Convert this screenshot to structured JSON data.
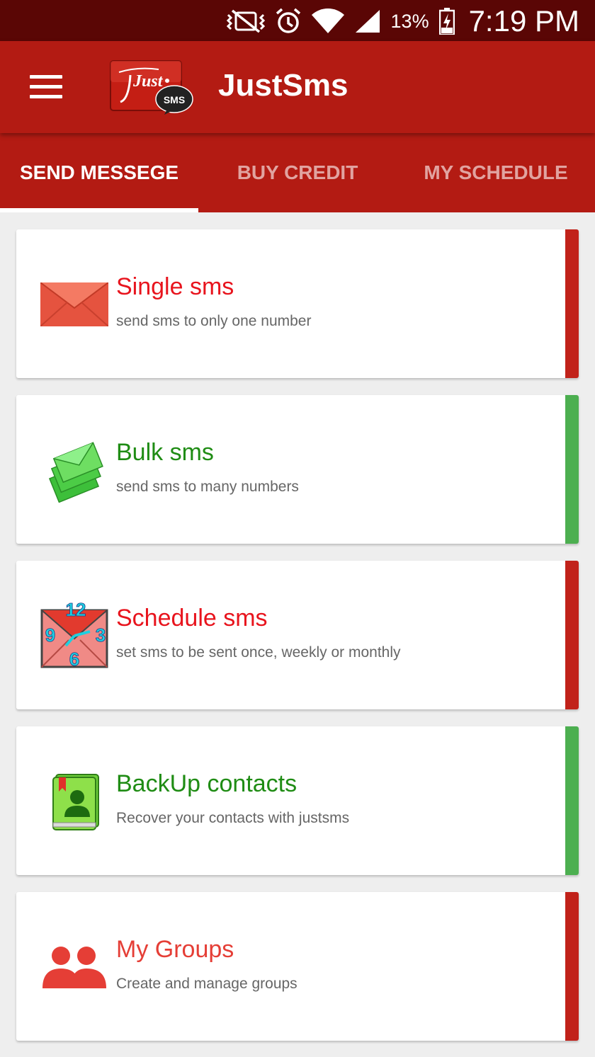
{
  "status_bar": {
    "battery_percent": "13%",
    "time": "7:19 PM",
    "icons": [
      "vibrate-icon",
      "alarm-icon",
      "wifi-icon",
      "signal-icon",
      "battery-charging-icon"
    ]
  },
  "app_bar": {
    "title": "JustSms",
    "logo_text": "Just",
    "logo_badge": "SMS",
    "menu_icon": "hamburger-menu-icon"
  },
  "tabs": [
    {
      "label": "SEND MESSEGE",
      "active": true
    },
    {
      "label": "BUY CREDIT",
      "active": false
    },
    {
      "label": "MY SCHEDULE",
      "active": false
    }
  ],
  "colors": {
    "primary": "#b31b13",
    "status_bar": "#5a0605",
    "red_accent": "#e8141d",
    "green_accent": "#1f8c14",
    "red_stripe": "#c1221a",
    "green_stripe": "#4caf50"
  },
  "cards": [
    {
      "title": "Single sms",
      "subtitle": "send sms to only one number",
      "icon": "envelope-icon",
      "accent": "red"
    },
    {
      "title": "Bulk sms",
      "subtitle": "send sms to many numbers",
      "icon": "stacked-envelopes-icon",
      "accent": "green"
    },
    {
      "title": "Schedule sms",
      "subtitle": "set sms to be sent once, weekly or monthly",
      "icon": "clock-envelope-icon",
      "accent": "red",
      "clock_numbers": [
        "12",
        "3",
        "6",
        "9"
      ]
    },
    {
      "title": "BackUp contacts",
      "subtitle": "Recover your contacts with justsms",
      "icon": "contacts-book-icon",
      "accent": "green"
    },
    {
      "title": "My Groups",
      "subtitle": "Create and manage groups",
      "icon": "group-icon",
      "accent": "red"
    }
  ]
}
